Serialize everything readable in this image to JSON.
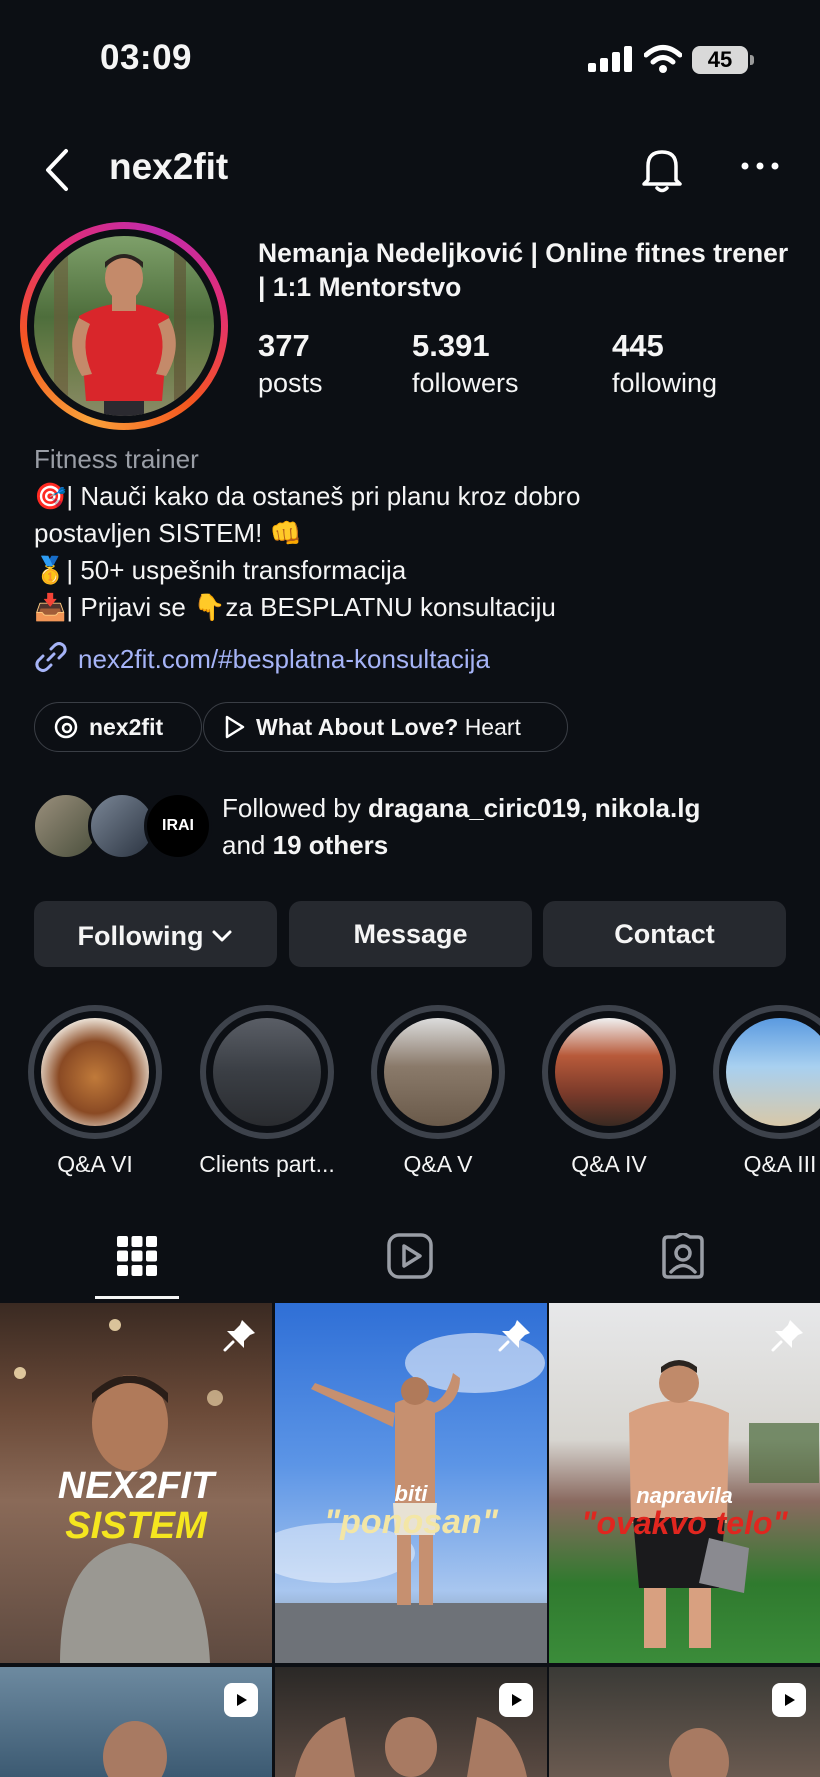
{
  "status": {
    "time": "03:09",
    "battery": "45"
  },
  "header": {
    "username": "nex2fit"
  },
  "profile": {
    "full_name": "Nemanja Nedeljković | Online fitnes trener | 1:1 Mentorstvo",
    "stats": [
      {
        "value": "377",
        "label": "posts"
      },
      {
        "value": "5.391",
        "label": "followers"
      },
      {
        "value": "445",
        "label": "following"
      }
    ],
    "category": "Fitness trainer",
    "bio": [
      "🎯| Nauči kako da ostaneš pri planu kroz dobro",
      "postavljen SISTEM! 👊",
      "🥇| 50+ uspešnih transformacija",
      "📥| Prijavi se 👇za BESPLATNU konsultaciju"
    ],
    "link": "nex2fit.com/#besplatna-konsultacija",
    "threads_chip": "nex2fit",
    "music_chip": {
      "title": "What About Love?",
      "artist": "Heart"
    },
    "mutual_avatar_text": "IRAI",
    "followed_by": {
      "prefix": "Followed by ",
      "names": "dragana_ciric019, nikola.lg",
      "and": "and ",
      "others": "19 others"
    }
  },
  "actions": {
    "following": "Following",
    "message": "Message",
    "contact": "Contact"
  },
  "highlights": [
    {
      "label": "Q&A VI"
    },
    {
      "label": "Clients part..."
    },
    {
      "label": "Q&A V"
    },
    {
      "label": "Q&A IV"
    },
    {
      "label": "Q&A III"
    }
  ],
  "tabs": [
    "grid-icon",
    "reels-icon",
    "tagged-icon"
  ],
  "posts": [
    {
      "caption_top": "NEX2FIT",
      "caption_bottom": "SISTEM",
      "pinned": true
    },
    {
      "caption_top": "biti",
      "caption_bottom": "\"ponosan\"",
      "pinned": true
    },
    {
      "caption_top": "napravila",
      "caption_bottom": "\"ovakvo telo\"",
      "pinned": true
    },
    {
      "type": "reel"
    },
    {
      "type": "reel"
    },
    {
      "type": "reel"
    }
  ],
  "colors": {
    "background": "#0c0f14",
    "button": "#26292f",
    "link": "#a6b4f7",
    "muted": "#9a9ea6"
  }
}
